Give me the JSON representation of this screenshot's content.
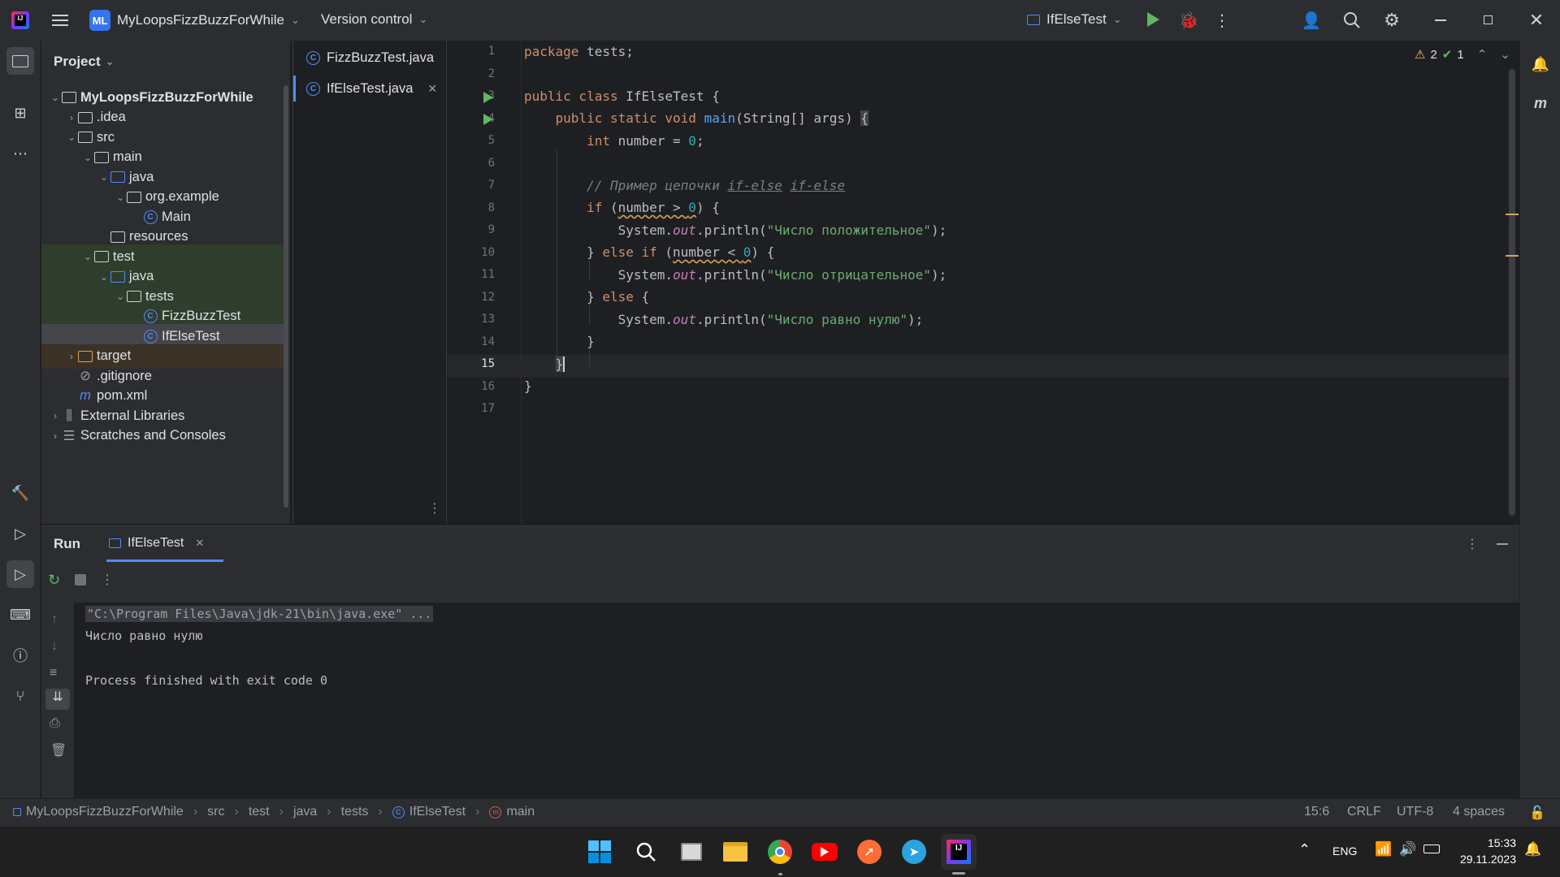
{
  "titlebar": {
    "project_badge": "ML",
    "project_name": "MyLoopsFizzBuzzForWhile",
    "vcs": "Version control",
    "run_config": "IfElseTest"
  },
  "project_panel": {
    "title": "Project",
    "tree": [
      {
        "label": "MyLoopsFizzBuzzForWhile",
        "type": "module",
        "bold": true
      },
      {
        "label": ".idea",
        "type": "folder"
      },
      {
        "label": "src",
        "type": "folder"
      },
      {
        "label": "main",
        "type": "folder"
      },
      {
        "label": "java",
        "type": "folder-blue"
      },
      {
        "label": "org.example",
        "type": "package"
      },
      {
        "label": "Main",
        "type": "class"
      },
      {
        "label": "resources",
        "type": "folder"
      },
      {
        "label": "test",
        "type": "folder"
      },
      {
        "label": "java",
        "type": "folder-green"
      },
      {
        "label": "tests",
        "type": "package"
      },
      {
        "label": "FizzBuzzTest",
        "type": "class"
      },
      {
        "label": "IfElseTest",
        "type": "class"
      },
      {
        "label": "target",
        "type": "folder-orange"
      },
      {
        "label": ".gitignore",
        "type": "ignore"
      },
      {
        "label": "pom.xml",
        "type": "maven"
      },
      {
        "label": "External Libraries",
        "type": "libs"
      },
      {
        "label": "Scratches and Consoles",
        "type": "scratch"
      }
    ]
  },
  "tabs": [
    {
      "label": "FizzBuzzTest.java",
      "active": false
    },
    {
      "label": "IfElseTest.java",
      "active": true
    }
  ],
  "editor": {
    "inspections": {
      "warnings": "2",
      "ok": "1"
    },
    "line_numbers": [
      "1",
      "2",
      "3",
      "4",
      "5",
      "6",
      "7",
      "8",
      "9",
      "10",
      "11",
      "12",
      "13",
      "14",
      "15",
      "16",
      "17"
    ],
    "current_line": "15"
  },
  "run_panel": {
    "title": "Run",
    "tab": "IfElseTest",
    "console": [
      "\"C:\\Program Files\\Java\\jdk-21\\bin\\java.exe\" ...",
      "Число равно нулю",
      "",
      "Process finished with exit code 0"
    ]
  },
  "statusbar": {
    "breadcrumbs": [
      "MyLoopsFizzBuzzForWhile",
      "src",
      "test",
      "java",
      "tests",
      "IfElseTest",
      "main"
    ],
    "position": "15:6",
    "line_sep": "CRLF",
    "encoding": "UTF-8",
    "indent": "4 spaces"
  },
  "taskbar": {
    "lang": "ENG",
    "time": "15:33",
    "date": "29.11.2023"
  },
  "colors": {
    "accent": "#3574f0",
    "keyword": "#cf8e6d",
    "string": "#6aab73",
    "number": "#2aacb8",
    "run_green": "#5fb865"
  }
}
